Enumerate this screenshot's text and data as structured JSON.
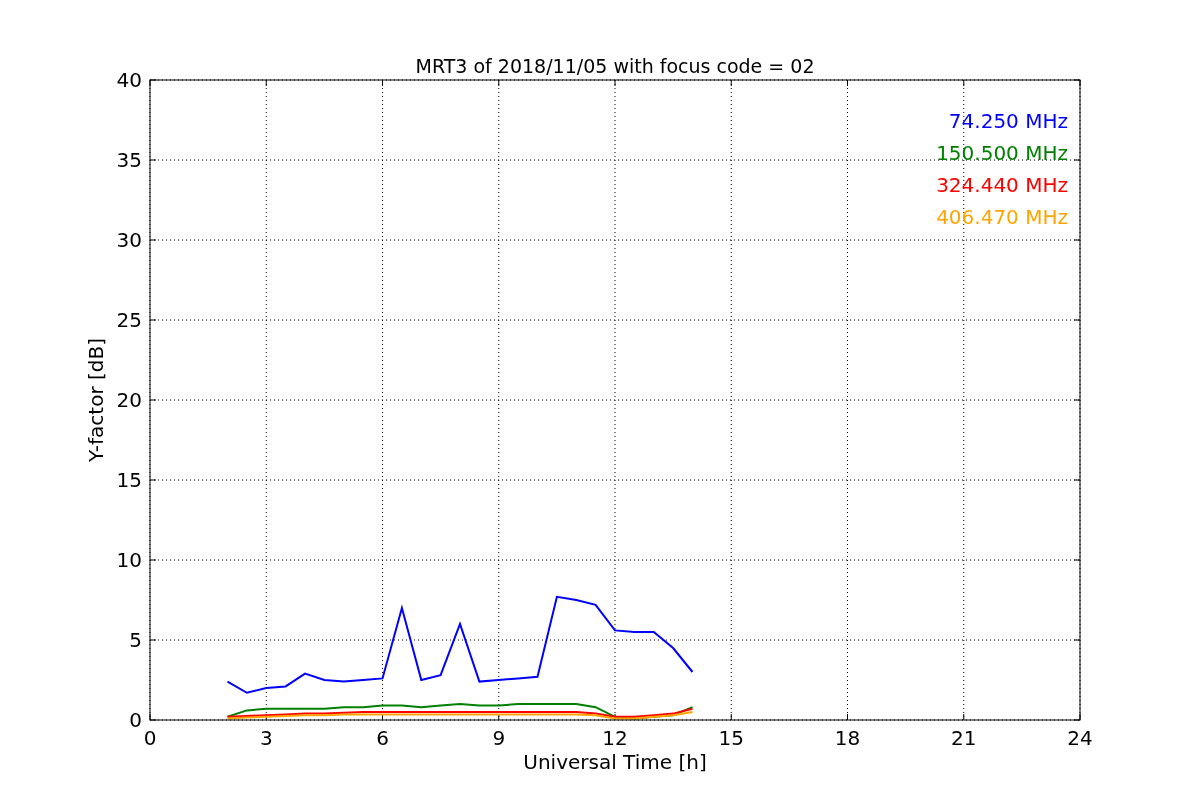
{
  "chart_data": {
    "type": "line",
    "title": "MRT3 of 2018/11/05 with focus code = 02",
    "xlabel": "Universal Time [h]",
    "ylabel": "Y-factor [dB]",
    "x": [
      2.0,
      2.5,
      3.0,
      3.5,
      4.0,
      4.5,
      5.0,
      5.5,
      6.0,
      6.5,
      7.0,
      7.5,
      8.0,
      8.5,
      9.0,
      9.5,
      10.0,
      10.5,
      11.0,
      11.5,
      12.0,
      12.5,
      13.0,
      13.5,
      14.0
    ],
    "series": [
      {
        "name": "74.250 MHz",
        "color": "#0000ff",
        "values": [
          2.4,
          1.7,
          2.0,
          2.1,
          2.9,
          2.5,
          2.4,
          2.5,
          2.6,
          7.0,
          2.5,
          2.8,
          6.0,
          2.4,
          2.5,
          2.6,
          2.7,
          7.7,
          7.5,
          7.2,
          5.6,
          5.5,
          5.5,
          4.5,
          3.0
        ]
      },
      {
        "name": "150.500 MHz",
        "color": "#008000",
        "values": [
          0.2,
          0.6,
          0.7,
          0.7,
          0.7,
          0.7,
          0.8,
          0.8,
          0.9,
          0.9,
          0.8,
          0.9,
          1.0,
          0.9,
          0.9,
          1.0,
          1.0,
          1.0,
          1.0,
          0.8,
          0.2,
          0.1,
          0.2,
          0.3,
          0.8
        ]
      },
      {
        "name": "324.440 MHz",
        "color": "#ff0000",
        "values": [
          0.2,
          0.25,
          0.3,
          0.35,
          0.4,
          0.4,
          0.45,
          0.5,
          0.5,
          0.5,
          0.5,
          0.5,
          0.5,
          0.5,
          0.5,
          0.5,
          0.5,
          0.5,
          0.5,
          0.4,
          0.2,
          0.2,
          0.3,
          0.4,
          0.7
        ]
      },
      {
        "name": "406.470 MHz",
        "color": "#ffa500",
        "values": [
          0.1,
          0.15,
          0.2,
          0.25,
          0.3,
          0.3,
          0.35,
          0.35,
          0.35,
          0.35,
          0.35,
          0.35,
          0.35,
          0.35,
          0.35,
          0.35,
          0.35,
          0.35,
          0.35,
          0.3,
          0.1,
          0.1,
          0.2,
          0.3,
          0.5
        ]
      }
    ],
    "grid": true,
    "xlim": [
      0,
      24
    ],
    "ylim": [
      0,
      40
    ],
    "xticks": [
      0,
      3,
      6,
      9,
      12,
      15,
      18,
      21,
      24
    ],
    "yticks": [
      0,
      5,
      10,
      15,
      20,
      25,
      30,
      35,
      40
    ]
  }
}
